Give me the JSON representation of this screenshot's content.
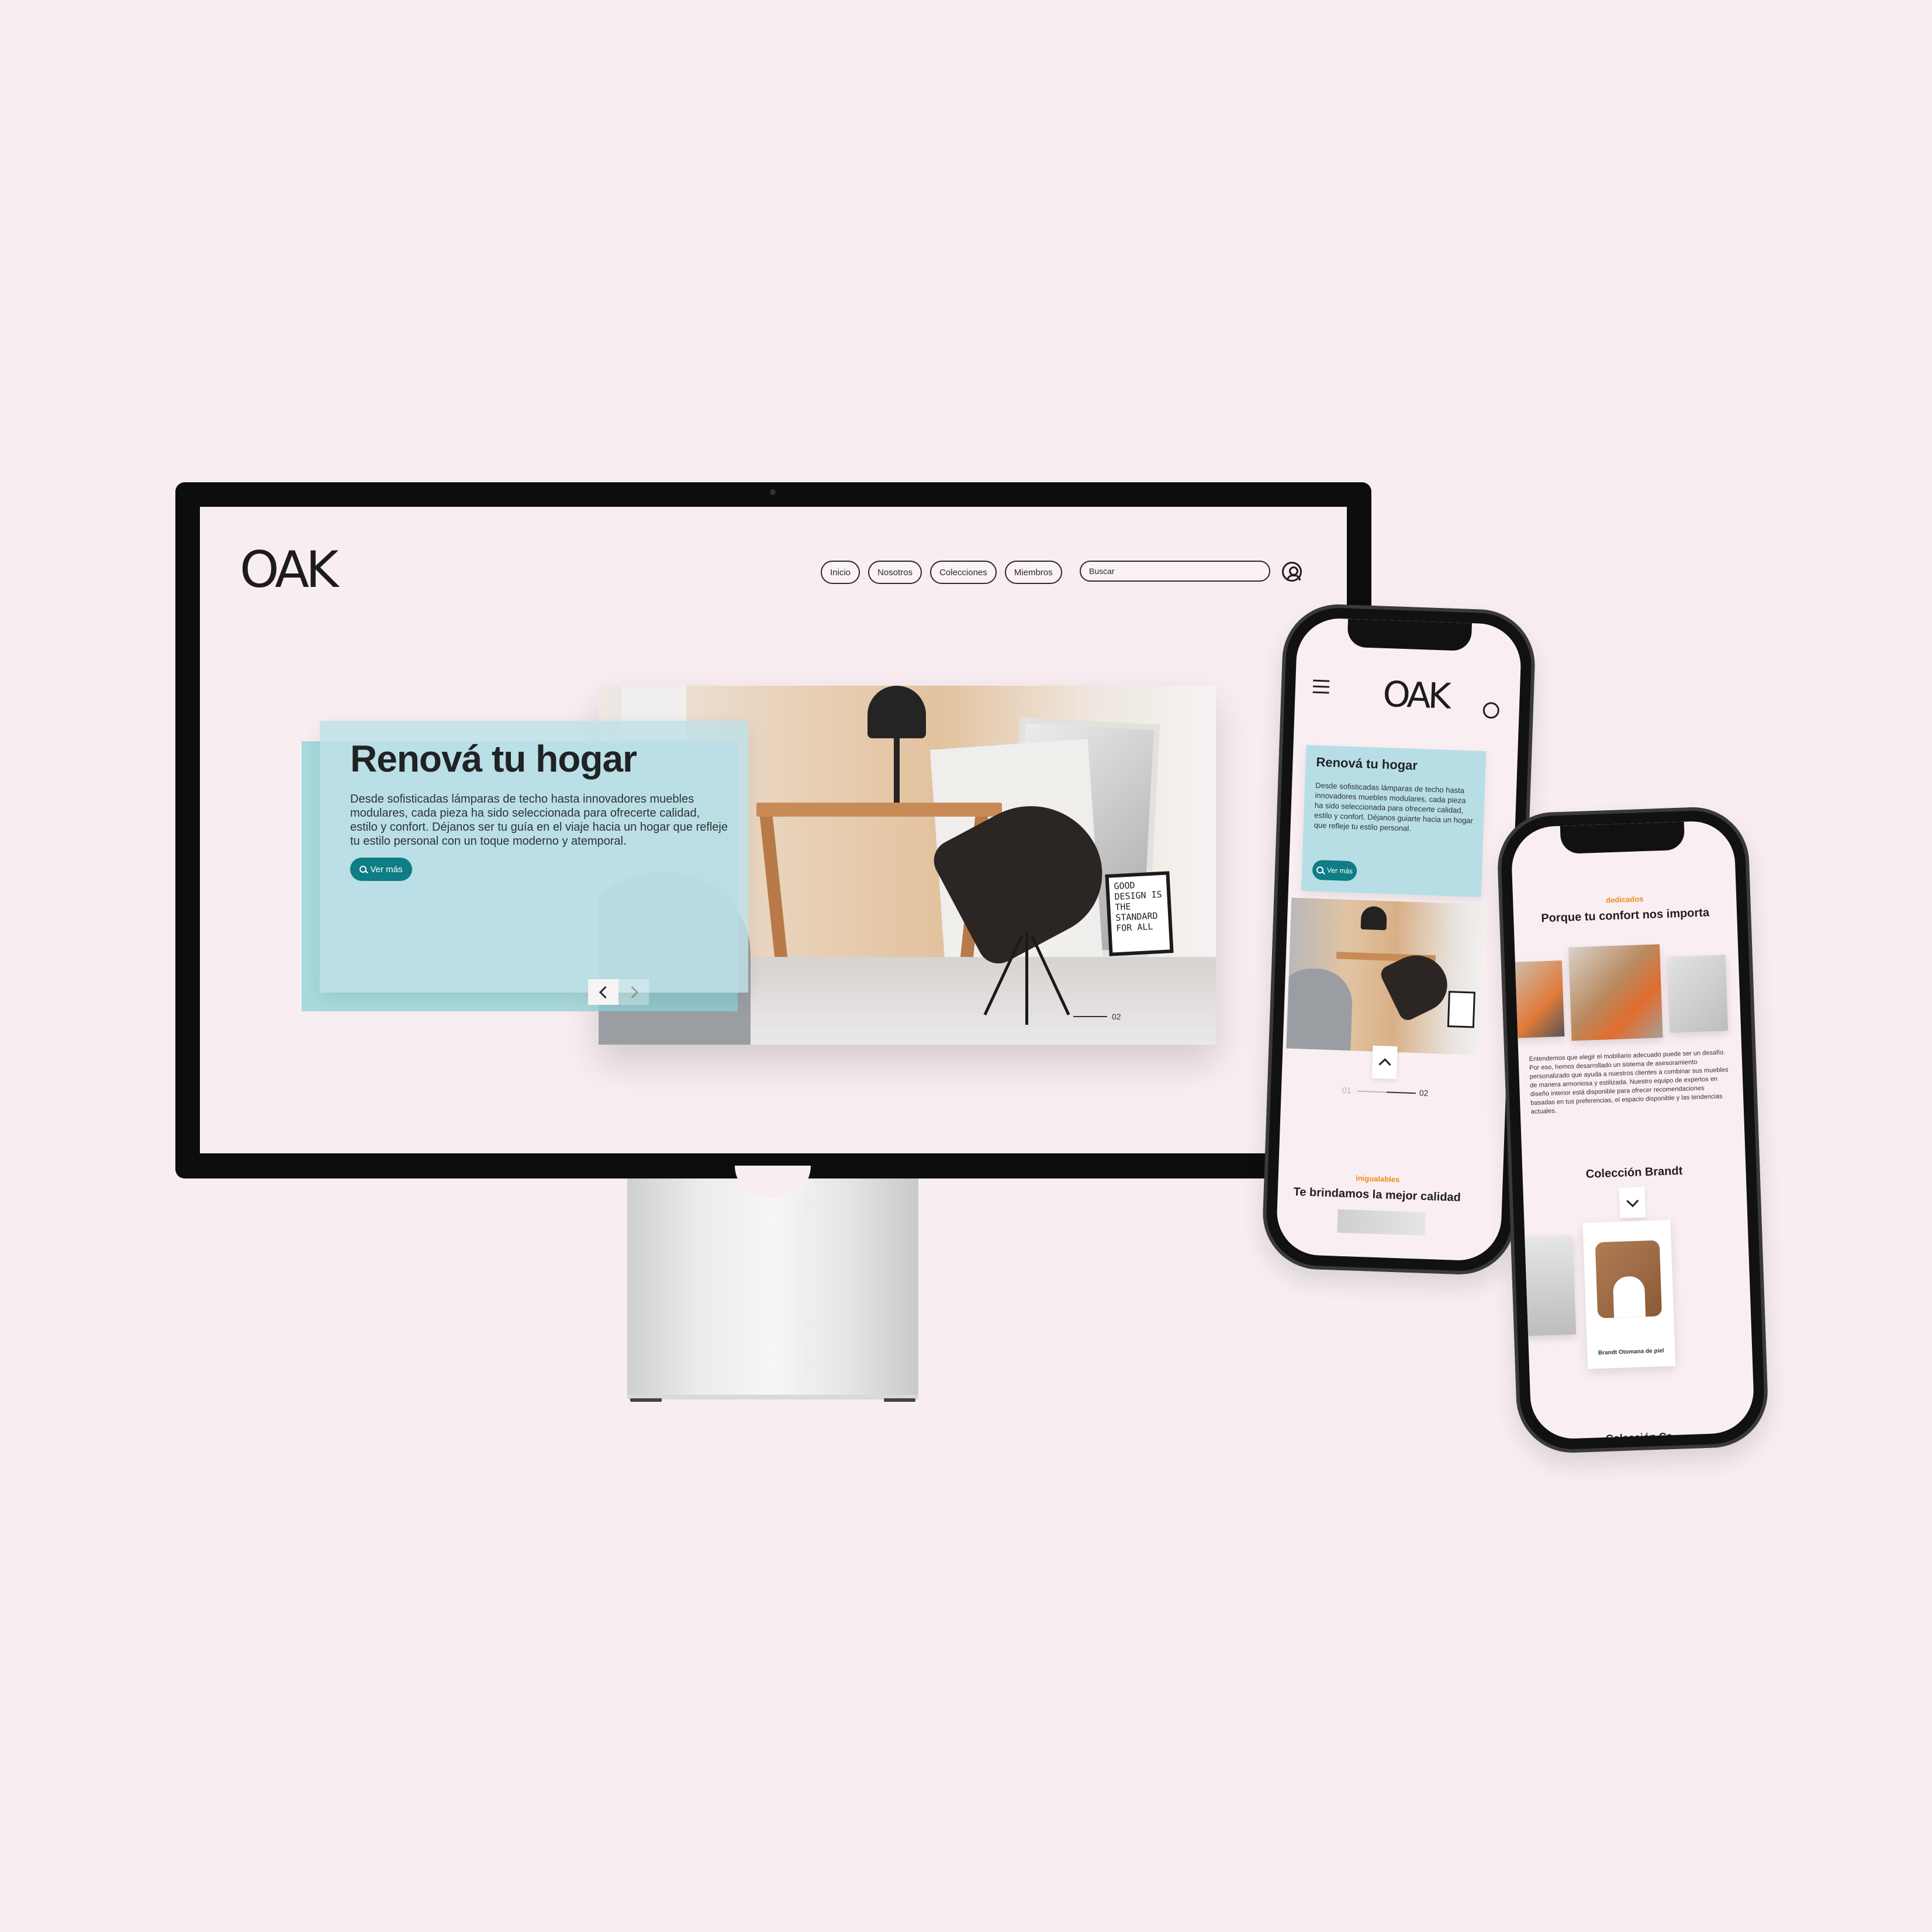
{
  "brand": {
    "logo": "OAK"
  },
  "desktop": {
    "nav": {
      "items": [
        "Inicio",
        "Nosotros",
        "Colecciones",
        "Miembros"
      ],
      "search_placeholder": "Buscar"
    },
    "hero": {
      "title": "Renová tu hogar",
      "text": "Desde sofisticadas lámparas de techo hasta innovadores muebles modulares, cada pieza ha sido seleccionada para ofrecerte calidad, estilo y confort. Déjanos ser tu guía en el viaje hacia un hogar que refleje tu estilo personal con un toque moderno y atemporal.",
      "button": "Ver más",
      "slide_counter": "02",
      "poster_text": "GOOD DESIGN IS THE STANDARD FOR ALL"
    }
  },
  "phone1": {
    "hero": {
      "title": "Renová tu hogar",
      "text": "Desde sofisticadas lámparas de techo hasta innovadores muebles modulares, cada pieza ha sido seleccionada para ofrecerte calidad, estilo y confort. Déjanos guiarte hacia un hogar que refleje tu estilo personal.",
      "button": "Ver más"
    },
    "counter_prev": "01",
    "counter_next": "02",
    "section": {
      "tag": "inigualables",
      "title": "Te brindamos la mejor calidad"
    }
  },
  "phone2": {
    "section": {
      "tag": "dedicados",
      "title": "Porque tu confort nos importa"
    },
    "paragraph": "Entendemos que elegir el mobiliario adecuado puede ser un desafío. Por eso, hemos desarrollado un sistema de asesoramiento personalizado que ayuda a nuestros clientes a combinar sus muebles de manera armoniosa y estilizada. Nuestro equipo de expertos en diseño interior está disponible para ofrecer recomendaciones basadas en tus preferencias, el espacio disponible y las tendencias actuales.",
    "collection_title": "Colección Brandt",
    "product_name": "Brandt Otomana de piel",
    "next_collection_partial": "Colección Ca..."
  },
  "colors": {
    "teal": "#0e7d86",
    "card": "#bfe1e8",
    "accent_orange": "#f08a1a",
    "background": "#f8eef2"
  }
}
